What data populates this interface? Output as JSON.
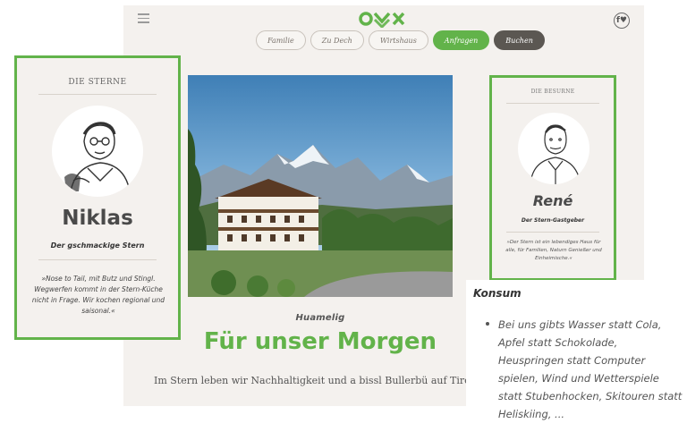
{
  "nav": {
    "items": [
      "Familie",
      "Zu Dech",
      "Wirtshaus",
      "Anfragen",
      "Buchen"
    ]
  },
  "card_left": {
    "label": "DIE STERNE",
    "name": "Niklas",
    "role": "Der gschmackige Stern",
    "quote": "»Nose to Tail, mit Butz und Stingl. Wegwerfen kommt in der Stern-Küche nicht in Frage. Wir kochen regional und saisonal.«"
  },
  "card_right": {
    "label": "DIE BESURNE",
    "name": "René",
    "role": "Der Stern-Gastgeber",
    "quote": "»Der Stern ist ein lebendiges Haus für alle, für Familien, Naturn Genießer und Einheimische.«"
  },
  "main": {
    "kicker": "Huamelig",
    "headline": "Für unser Morgen",
    "lead": "Im Stern leben wir Nachhaltigkeit und a bissl Bullerbü auf Tirolerisch!"
  },
  "konsum": {
    "title": "Konsum",
    "text": "Bei uns gibts Wasser statt Cola, Apfel statt Schokolade, Heuspringen statt Computer spielen, Wind und Wetterspiele statt Stubenhocken, Skitouren statt Heliskiing, ..."
  },
  "colors": {
    "accent_green": "#62b34a",
    "dark_button": "#5b5752",
    "page_background": "#f4f1ee"
  },
  "icons": [
    "menu-icon",
    "logo-icon",
    "facebook-icon"
  ]
}
